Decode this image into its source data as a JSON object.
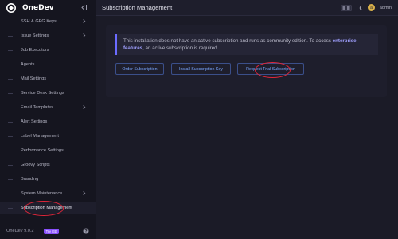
{
  "app": {
    "name": "OneDev",
    "version": "OneDev 9.0.2",
    "badge": "Try EE"
  },
  "sidebar": {
    "items": [
      {
        "label": "SSH & GPG Keys",
        "has_children": true
      },
      {
        "label": "Issue Settings",
        "has_children": true
      },
      {
        "label": "Job Executors",
        "has_children": false
      },
      {
        "label": "Agents",
        "has_children": false
      },
      {
        "label": "Mail Settings",
        "has_children": false
      },
      {
        "label": "Service Desk Settings",
        "has_children": false
      },
      {
        "label": "Email Templates",
        "has_children": true
      },
      {
        "label": "Alert Settings",
        "has_children": false
      },
      {
        "label": "Label Management",
        "has_children": false
      },
      {
        "label": "Performance Settings",
        "has_children": false
      },
      {
        "label": "Groovy Scripts",
        "has_children": false
      },
      {
        "label": "Branding",
        "has_children": false
      },
      {
        "label": "System Maintenance",
        "has_children": true
      },
      {
        "label": "Subscription Management",
        "has_children": false,
        "active": true
      }
    ]
  },
  "topbar": {
    "title": "Subscription Management",
    "avatar_initial": "a",
    "username": "admin"
  },
  "alert": {
    "text_before": "This installation does not have an active subscription and runs as community edition. To access ",
    "highlight": "enterprise features",
    "text_after": ", an active subscription is required"
  },
  "buttons": {
    "order": "Order Subscription",
    "install": "Install Subscription Key",
    "trial": "Request Trial Subscription"
  },
  "colors": {
    "accent": "#7aa7ff",
    "annotation": "#e0263a",
    "badge": "#8950fc"
  }
}
